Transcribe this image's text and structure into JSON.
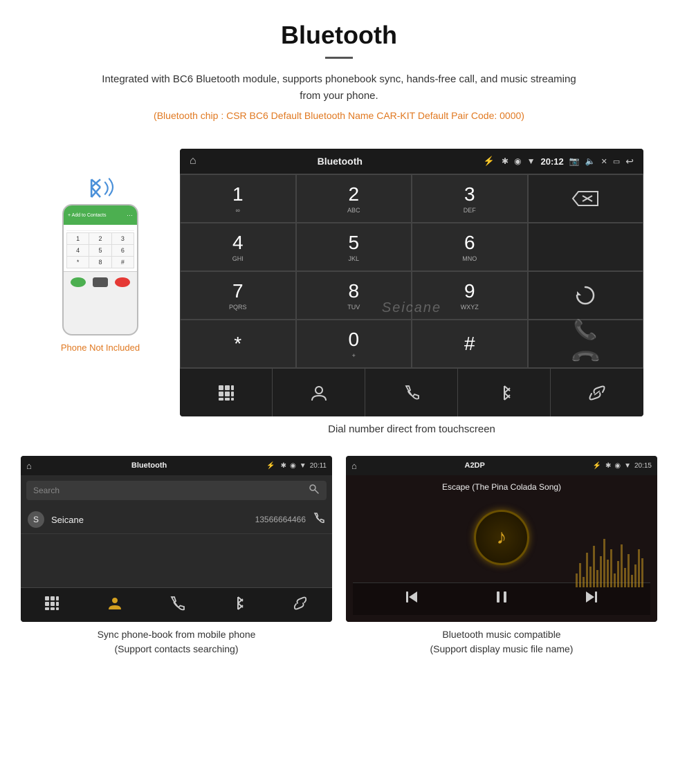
{
  "header": {
    "title": "Bluetooth",
    "description": "Integrated with BC6 Bluetooth module, supports phonebook sync, hands-free call, and music streaming from your phone.",
    "specs": "(Bluetooth chip : CSR BC6    Default Bluetooth Name CAR-KIT    Default Pair Code: 0000)"
  },
  "dialpad": {
    "statusbar": {
      "title": "Bluetooth",
      "time": "20:12"
    },
    "keys": [
      {
        "num": "1",
        "sub": "∞"
      },
      {
        "num": "2",
        "sub": "ABC"
      },
      {
        "num": "3",
        "sub": "DEF"
      },
      {
        "num": "*",
        "sub": ""
      },
      {
        "num": "4",
        "sub": "GHI"
      },
      {
        "num": "5",
        "sub": "JKL"
      },
      {
        "num": "6",
        "sub": "MNO"
      },
      {
        "num": "0",
        "sub": "+"
      },
      {
        "num": "7",
        "sub": "PQRS"
      },
      {
        "num": "8",
        "sub": "TUV"
      },
      {
        "num": "9",
        "sub": "WXYZ"
      },
      {
        "num": "#",
        "sub": ""
      }
    ],
    "caption": "Dial number direct from touchscreen"
  },
  "phonebook": {
    "statusbar": {
      "title": "Bluetooth",
      "time": "20:11"
    },
    "search_placeholder": "Search",
    "contacts": [
      {
        "letter": "S",
        "name": "Seicane",
        "number": "13566664466"
      }
    ],
    "caption": "Sync phone-book from mobile phone\n(Support contacts searching)"
  },
  "music": {
    "statusbar": {
      "title": "A2DP",
      "time": "20:15"
    },
    "song_title": "Escape (The Pina Colada Song)",
    "caption": "Bluetooth music compatible\n(Support display music file name)"
  },
  "phone_label": {
    "not_included": "Phone Not Included"
  }
}
